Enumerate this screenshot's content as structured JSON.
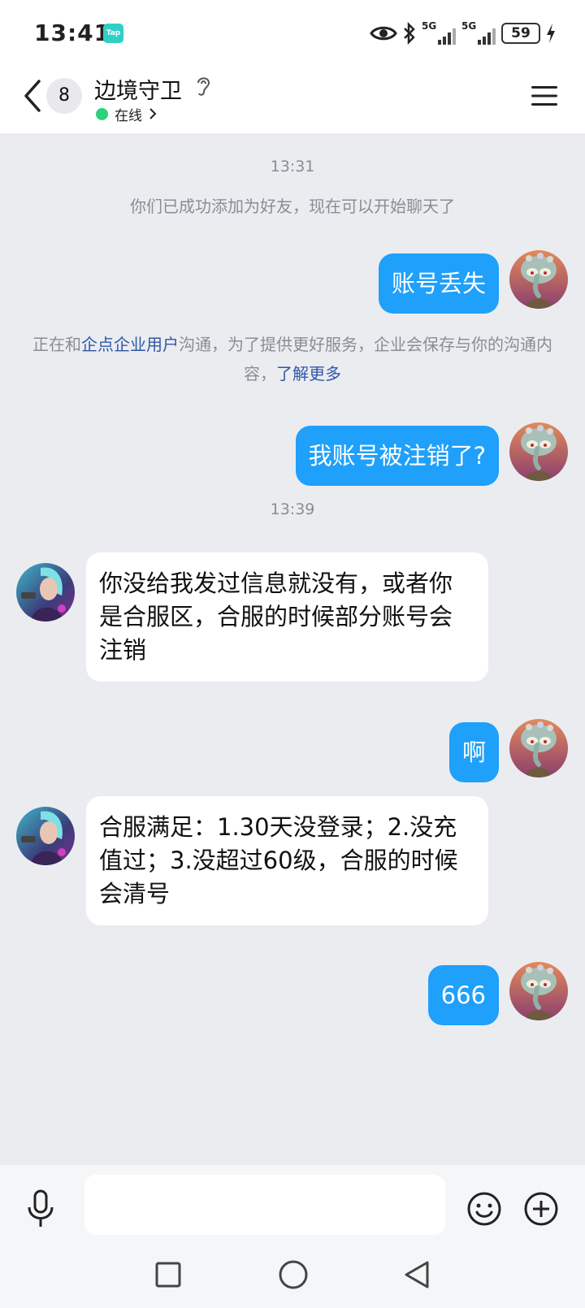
{
  "status_bar": {
    "time": "13:41",
    "tap_label": "Tap",
    "signal1_label": "5G",
    "signal2_label": "5G",
    "battery": "59",
    "icons": [
      "eye-icon",
      "bluetooth-icon",
      "signal-icon",
      "signal-icon",
      "battery-icon",
      "charging-icon"
    ]
  },
  "header": {
    "unread_count": "8",
    "contact_name": "边境守卫",
    "status": "在线",
    "icons": [
      "back-arrow-icon",
      "ear-icon",
      "chevron-right-icon",
      "menu-icon"
    ]
  },
  "chat": {
    "timestamp1": "13:31",
    "system_friend_added": "你们已成功添加为好友，现在可以开始聊天了",
    "msg1": "账号丢失",
    "notice_prefix": "正在和",
    "notice_link": "企点企业用户",
    "notice_middle": "沟通，为了提供更好服务，企业会保存与你的沟通内容，",
    "notice_more": "了解更多",
    "msg2": "我账号被注销了?",
    "timestamp2": "13:39",
    "reply1": "你没给我发过信息就没有，或者你是合服区，合服的时候部分账号会注销",
    "msg3": "啊",
    "reply2": "合服满足：1.30天没登录；2.没充值过；3.没超过60级，合服的时候会清号",
    "msg4": "666"
  },
  "input_bar": {
    "value": "",
    "placeholder": "",
    "icons": [
      "microphone-icon",
      "emoji-icon",
      "plus-icon"
    ]
  },
  "nav_bar": {
    "icons": [
      "recent-apps-icon",
      "home-icon",
      "back-icon"
    ]
  },
  "colors": {
    "my_bubble": "#1fa0fa",
    "chat_background": "#ebecf0",
    "online": "#2ad27a",
    "link": "#2f57a6"
  }
}
